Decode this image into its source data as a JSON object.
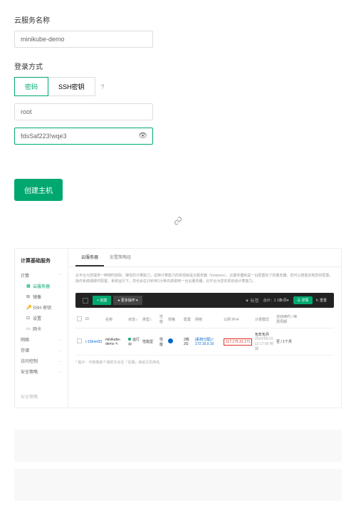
{
  "form": {
    "service_name_label": "云服务名称",
    "service_name_value": "minikube-demo",
    "login_method_label": "登录方式",
    "tab_password": "密码",
    "tab_ssh": "SSH密钥",
    "username_value": "root",
    "password_value": "fdsSaf223!wqe3"
  },
  "create_button": "创建主机",
  "sidebar": {
    "title": "计算基础服务",
    "groups": [
      {
        "label": "计算",
        "items": [
          {
            "icon": "▦",
            "label": "云服务器",
            "active": true
          },
          {
            "icon": "⊞",
            "label": "镜像"
          },
          {
            "icon": "🔑",
            "label": "SSH 密钥"
          },
          {
            "icon": "⊡",
            "label": "设置"
          },
          {
            "icon": "▭",
            "label": "网卡"
          }
        ]
      },
      {
        "label": "网络"
      },
      {
        "label": "存储"
      },
      {
        "label": "访问控制"
      },
      {
        "label": "安全策略"
      }
    ],
    "footer": "安全策略"
  },
  "main": {
    "tabs": [
      {
        "label": "云服务器",
        "active": true
      },
      {
        "label": "安置策略组"
      }
    ],
    "description": "云平台为您提供一种随时获取、弹性的计算能力，这种计算能力的体现就是云服务器（Instance）。云服务器就是一台配置好了的服务器，您可以按需定制您的配置，操作系统或硬件配置。系统运行下，您也会在10秒到1分钟内获取到一台云服务器，云平台为您实现自动计算能力。",
    "toolbar": {
      "create": "+ 创建",
      "more": "● 更多操作 ▾",
      "filter": "▼ 标签",
      "count": "合计：1 1条/页▾",
      "detail": "☰ 详情",
      "reset": "↻ 重置"
    },
    "columns": {
      "id": "ID",
      "name": "名称",
      "status": "状态",
      "type": "类型",
      "op": "性能",
      "model": "规格",
      "config": "配置",
      "network": "网络",
      "ip": "公网 IPv4",
      "billing": "计费模式",
      "auto": "自动续约 / 续费周期"
    },
    "row": {
      "id": "i-1SIner03",
      "name": "minikube-demo",
      "edit_icon": "✎",
      "status_text": "运行中",
      "type": "性能型",
      "model": "性能",
      "config_icon": "●",
      "network_vpc": "2核2G",
      "network_ip": "[系统分配] / 172.16.0.10",
      "public_ip": "117.175.31.171",
      "billing_mode": "包年包月",
      "billing_date": "2024-06-23 12:17:00 到期",
      "auto": "否 / 1个月"
    },
    "note": "* 提示：可拖拽各个域依次点击「名额」来给主机命名"
  }
}
